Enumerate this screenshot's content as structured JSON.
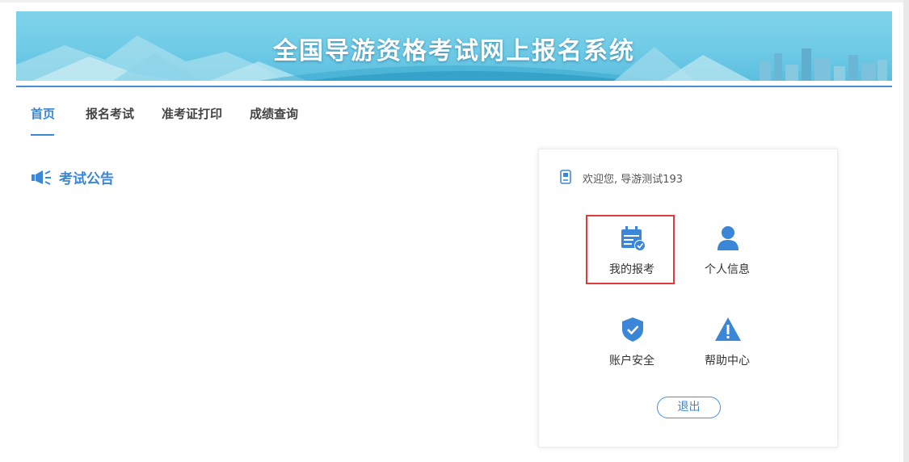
{
  "banner": {
    "title": "全国导游资格考试网上报名系统"
  },
  "nav": {
    "items": [
      {
        "label": "首页",
        "active": true
      },
      {
        "label": "报名考试",
        "active": false
      },
      {
        "label": "准考证打印",
        "active": false
      },
      {
        "label": "成绩查询",
        "active": false
      }
    ]
  },
  "notice": {
    "label": "考试公告",
    "icon": "megaphone-icon"
  },
  "user_panel": {
    "welcome": "欢迎您, 导游测试193",
    "tiles": [
      {
        "label": "我的报考",
        "icon": "calendar-check-icon",
        "highlighted": true
      },
      {
        "label": "个人信息",
        "icon": "user-icon",
        "highlighted": false
      },
      {
        "label": "账户安全",
        "icon": "shield-check-icon",
        "highlighted": false
      },
      {
        "label": "帮助中心",
        "icon": "warning-icon",
        "highlighted": false
      }
    ],
    "logout_label": "退出"
  },
  "colors": {
    "accent": "#3b86d6",
    "highlight_border": "#e03a3a",
    "banner": "#6fcbe6"
  }
}
